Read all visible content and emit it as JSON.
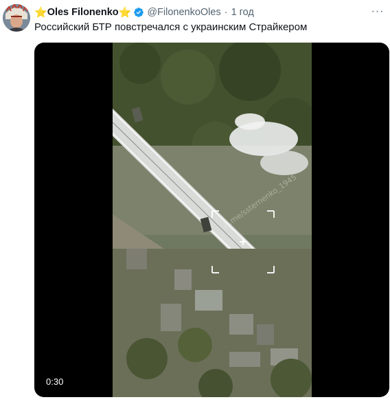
{
  "tweet": {
    "star_left": "⭐",
    "author_name": "Oles Filonenko",
    "star_right": "⭐",
    "handle": "@FilonenkoOles",
    "separator": "·",
    "time": "1 год",
    "text": "Российский БТР повстречался с украинским Страйкером",
    "more_label": "···"
  },
  "media": {
    "duration": "0:30",
    "watermark": "/t.me/ssternenko_1945"
  },
  "colors": {
    "verified": "#1d9bf0",
    "star": "#f5b400",
    "secondary_text": "#536471"
  },
  "icons": [
    "verified-badge-icon",
    "more-options-icon",
    "star-icon"
  ]
}
